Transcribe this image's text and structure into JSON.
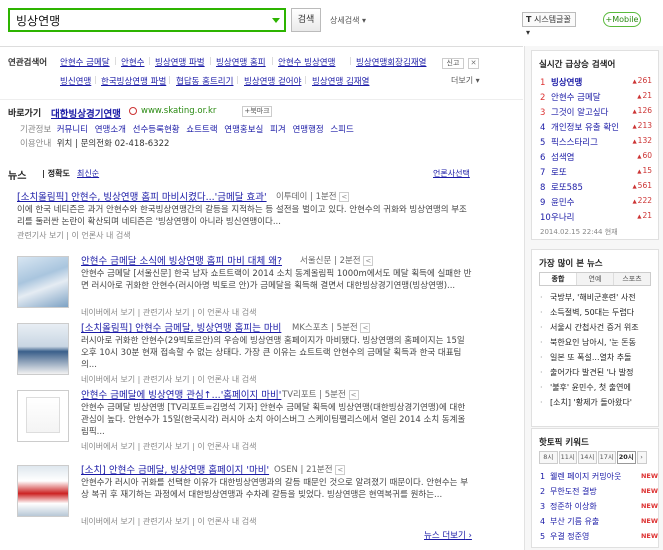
{
  "search": {
    "query": "빙상연맹",
    "button_label": "검색",
    "detail_label": "상세검색",
    "lang_label": "시스템글꼴",
    "mobile_label": "+Mobile"
  },
  "related": {
    "label": "연관검색어",
    "items": [
      "안현수 금메달",
      "안현수",
      "빙상연맹 파벌",
      "빙상연맹 홈피",
      "안현수 빙상연맹",
      "빙상연맹회장",
      "김재열",
      "빙신연맹",
      "한국빙상연맹 파벌",
      "협답동 홈트리기",
      "빙상연맹 걷어야",
      "빙상연맹 김재열"
    ],
    "close_label": "신고",
    "more_label": "더보기"
  },
  "shortcut": {
    "title": "바로가기",
    "name": "대한빙상경기연맹",
    "url": "www.skating.or.kr",
    "bookmark_label": "북마크",
    "row1_key": "기관정보",
    "row1_links": [
      "커뮤니티",
      "연맹소개",
      "선수등록현황",
      "쇼트트랙",
      "연맹홍보실",
      "피겨",
      "연맹행정",
      "스피드"
    ],
    "row2_key": "이용안내",
    "row2_text": "위치 | 문의전화 02-418-6322"
  },
  "news": {
    "title": "뉴스",
    "sort_accuracy": "정확도",
    "sort_latest": "최신순",
    "press_label": "언론사선택",
    "more_label": "뉴스 더보기",
    "articles": [
      {
        "headline": "[소치올림픽] 안현수, 빙상연맹 홈피 마비시켰다...'금메달 효과'",
        "source": "이투데이",
        "time": "1분전",
        "body": "이에 한국 네티즌은 과거 안현수와 한국빙상연맹간의 갈등을 지적하는 등 설전을 벌이고 있다. 안현수의 귀화와 빙상연맹의 부조리를 둘러싼 논란이 확산되며 네티즌은 '빙상연맹이 아니라 빙신연맹이다...",
        "meta": "관련기사 보기 | 이 언론사 내 검색"
      },
      {
        "headline": "안현수 금메달 소식에 빙상연맹 홈피 마비 대체 왜?",
        "source": "서울신문",
        "time": "2분전",
        "body": "안현수 금메달 [서울신문] 한국 남자 쇼트트랙이 2014 소치 동계올림픽 1000m에서도 메달 획득에 실패한 반면 러시아로 귀화한 안현수(러시아명 빅토르 안)가 금메달을 획득해 결면서 대한빙상경기연맹(빙상연맹)...",
        "meta": "네이버에서 보기 | 관련기사 보기 | 이 언론사 내 검색"
      },
      {
        "headline": "[소치올림픽] 안현수 금메달, 빙상연맹 홈피는 마비",
        "source": "MK스포츠",
        "time": "5분전",
        "body": "러시아로 귀화한 안현수(29빅토르안)의 우승에 빙상연맹 홈페이지가 마비됐다. 빙상연맹의 홈페이지는 15일 오후 10시 30분 현재 접속할 수 없는 상태다. 가장 큰 이유는 쇼트트랙 안현수의 금메달 획득과 한국 대표팀의...",
        "meta": "네이버에서 보기 | 관련기사 보기 | 이 언론사 내 검색"
      },
      {
        "headline": "안현수 금메달에 빙상연맹 관심↑...'홈페이지 마비'",
        "source": "TV리포트",
        "time": "5분전",
        "body": "안현수 금메달 빙상연맹 [TV리포트=김명석 기자] 안현수 금메달 획득에 빙상연맹(대한빙상경기연맹)에 대한 관심이 높다. 안현수가 15일(한국시각) 러시아 소치 아이스버그 스케이팅팰리스에서 열린 2014 소치 동계올림픽...",
        "meta": "네이버에서 보기 | 관련기사 보기 | 이 언론사 내 검색"
      },
      {
        "headline": "[소치] 안현수 금메달, 빙상연맹 홈페이지 '마비'",
        "source": "OSEN",
        "time": "21분전",
        "body": "안현수가 러시아 귀화를 선택한 이유가 대한빙상연맹과의 갈등 때문인 것으로 알려졌기 때문이다. 안현수는 부상 복귀 후 재기하는 과정에서 대한빙상연맹과 수차례 갈등을 빚었다. 빙상연맹은 현역복귀를 원하는...",
        "meta": "네이버에서 보기 | 관련기사 보기 | 이 언론사 내 검색"
      }
    ]
  },
  "realtime": {
    "title": "실시간 급상승 검색어",
    "items": [
      {
        "rank": "1",
        "word": "빙상연맹",
        "change": "261"
      },
      {
        "rank": "2",
        "word": "안현수 금메달",
        "change": "21"
      },
      {
        "rank": "3",
        "word": "그것이 알고싶다",
        "change": "126"
      },
      {
        "rank": "4",
        "word": "개인정보 유출 확인",
        "change": "213"
      },
      {
        "rank": "5",
        "word": "픽스스타리그",
        "change": "132"
      },
      {
        "rank": "6",
        "word": "섬색염",
        "change": "60"
      },
      {
        "rank": "7",
        "word": "로또",
        "change": "15"
      },
      {
        "rank": "8",
        "word": "로또585",
        "change": "561"
      },
      {
        "rank": "9",
        "word": "윤민수",
        "change": "222"
      },
      {
        "rank": "10",
        "word": "우나리",
        "change": "21"
      }
    ],
    "timestamp": "2014.02.15 22:44 현재"
  },
  "popular_news": {
    "title": "가장 많이 본 뉴스",
    "tabs": [
      "종합",
      "연예",
      "스포츠"
    ],
    "items": [
      "국방부, '해비군훈련' 사전",
      "소득절벽, 50대는 두렵다",
      "서울시 간첩사건 증거 위조",
      "북한요인 남아시, '눈 돈동",
      "일본 또 폭설...열차 추돌",
      "출어가다 발견된 '나 발정",
      "'불후' 윤민수, 첫 출연에",
      "[소치] '황제가 돌아왔다'"
    ]
  },
  "hot_keywords": {
    "title": "핫토픽 키워드",
    "hours": [
      "8시",
      "11시",
      "14시",
      "17시",
      "20시"
    ],
    "active_hour": "20시",
    "items": [
      {
        "rank": "1",
        "word": "웰렌 페이지 커밍아웃",
        "new": true
      },
      {
        "rank": "2",
        "word": "무한도전 결방",
        "new": true
      },
      {
        "rank": "3",
        "word": "정준하 이상화",
        "new": true
      },
      {
        "rank": "4",
        "word": "부산 기름 유출",
        "new": true
      },
      {
        "rank": "5",
        "word": "우결 정준영",
        "new": true
      }
    ],
    "new_label": "NEW"
  }
}
